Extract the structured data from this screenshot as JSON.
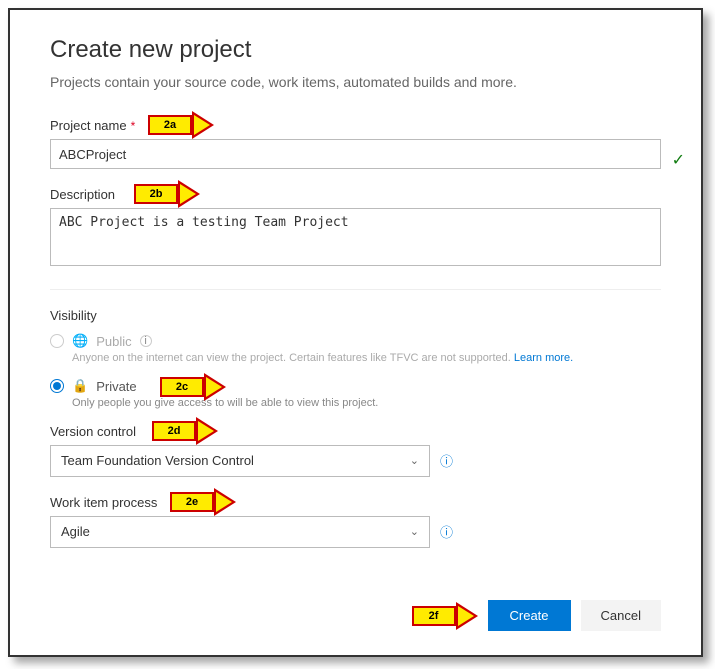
{
  "header": {
    "title": "Create new project",
    "subtitle": "Projects contain your source code, work items, automated builds and more."
  },
  "fields": {
    "project_name_label": "Project name",
    "project_name_value": "ABCProject",
    "description_label": "Description",
    "description_value": "ABC Project is a testing Team Project"
  },
  "visibility": {
    "label": "Visibility",
    "public_label": "Public",
    "public_sub": "Anyone on the internet can view the project. Certain features like TFVC are not supported.",
    "learn_more": "Learn more.",
    "private_label": "Private",
    "private_sub": "Only people you give access to will be able to view this project."
  },
  "version_control": {
    "label": "Version control",
    "value": "Team Foundation Version Control"
  },
  "work_item": {
    "label": "Work item process",
    "value": "Agile"
  },
  "buttons": {
    "create": "Create",
    "cancel": "Cancel"
  },
  "annotations": {
    "a": "2a",
    "b": "2b",
    "c": "2c",
    "d": "2d",
    "e": "2e",
    "f": "2f"
  }
}
